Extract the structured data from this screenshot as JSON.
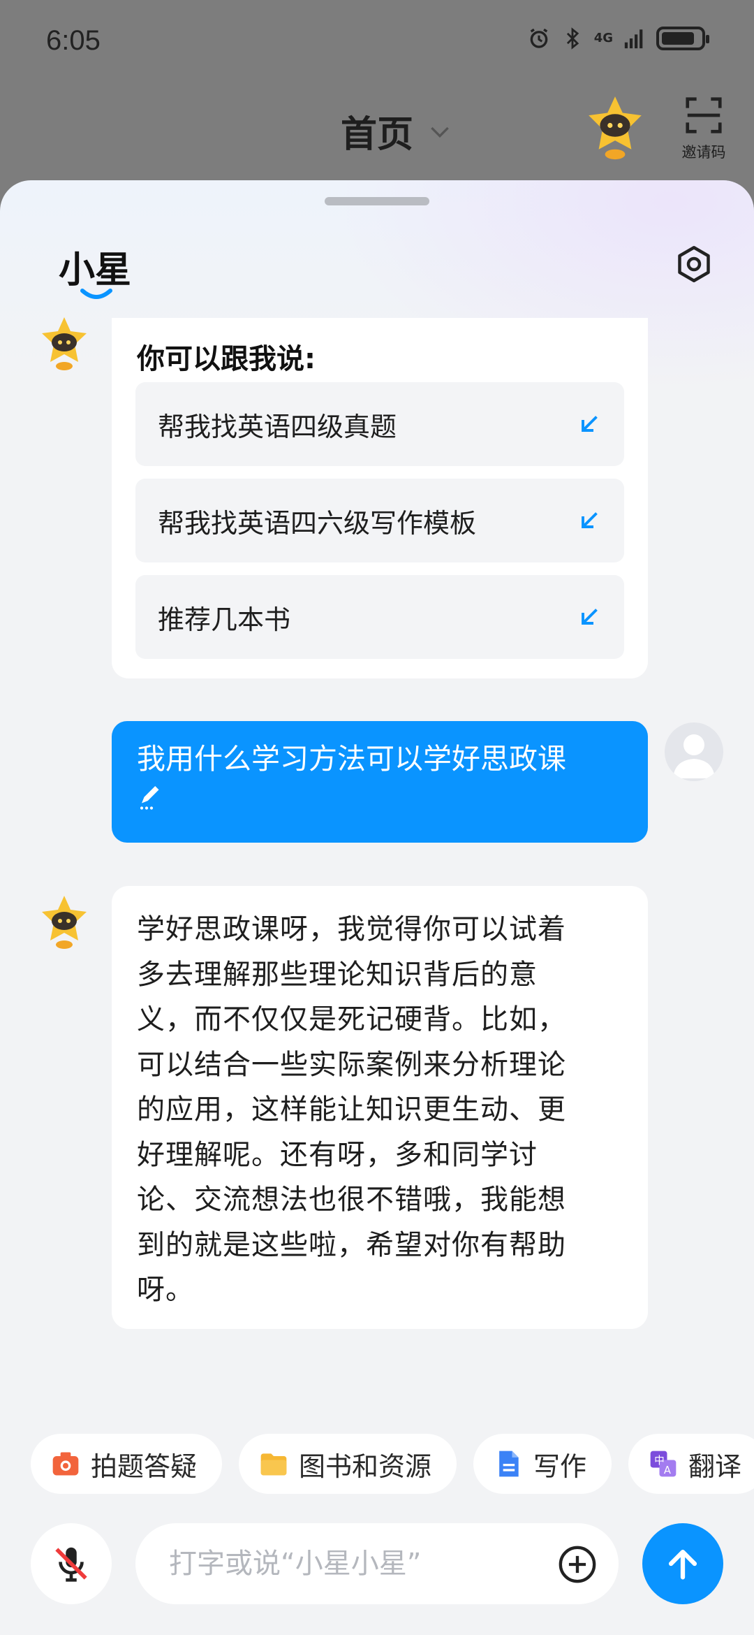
{
  "status_bar": {
    "time": "6:05",
    "network": "4G"
  },
  "top_nav": {
    "title": "首页",
    "invite_label": "邀请码"
  },
  "sheet": {
    "title": "小星"
  },
  "suggestions": {
    "title": "你可以跟我说:",
    "items": [
      {
        "label": "帮我找英语四级真题"
      },
      {
        "label": "帮我找英语四六级写作模板"
      },
      {
        "label": "推荐几本书"
      }
    ]
  },
  "user_message": {
    "text": "我用什么学习方法可以学好思政课"
  },
  "assistant_reply": {
    "lines": [
      "学好思政课呀，我觉得你可以试着",
      "多去理解那些理论知识背后的意",
      "义，而不仅仅是死记硬背。比如，",
      "可以结合一些实际案例来分析理论",
      "的应用，这样能让知识更生动、更",
      "好理解呢。还有呀，多和同学讨",
      "论、交流想法也很不错哦，我能想",
      "到的就是这些啦，希望对你有帮助",
      "呀。"
    ]
  },
  "shortcuts": [
    {
      "label": "拍题答疑",
      "icon": "camera-icon",
      "color": "#f2643c"
    },
    {
      "label": "图书和资源",
      "icon": "folder-icon",
      "color": "#f6b733"
    },
    {
      "label": "写作",
      "icon": "document-icon",
      "color": "#3b82f6"
    },
    {
      "label": "翻译",
      "icon": "translate-icon",
      "color": "#7c4ddc"
    }
  ],
  "input": {
    "placeholder": "打字或说“小星小星”"
  },
  "colors": {
    "accent": "#0a94ff",
    "sheet_bg": "#f2f3f5",
    "dim_bg": "#7d7d7d"
  }
}
